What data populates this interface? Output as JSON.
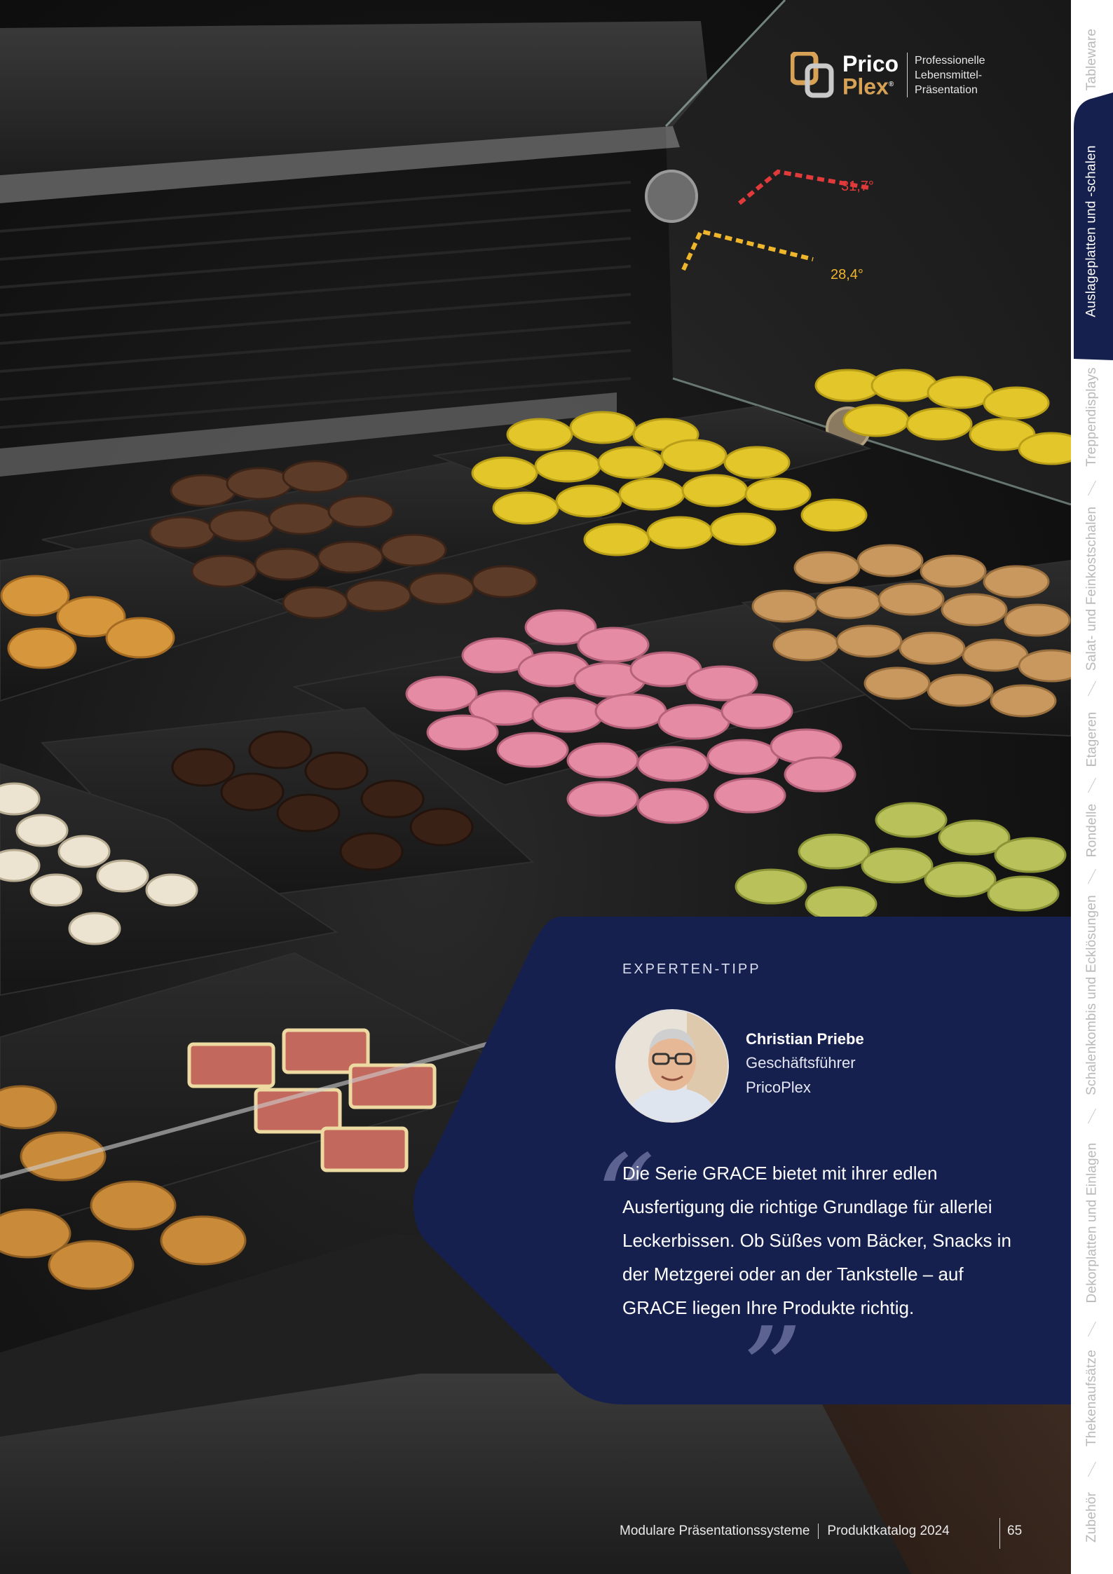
{
  "brand": {
    "word1": "Prico",
    "word2": "Plex",
    "registered": "®",
    "tagline": [
      "Professionelle",
      "Lebensmittel-",
      "Präsentation"
    ],
    "colors": {
      "gold": "#d7a256",
      "navy": "#16204f"
    }
  },
  "tabs": [
    {
      "label": "Tableware",
      "active": false
    },
    {
      "label": "Auslageplatten und -schalen",
      "active": true
    },
    {
      "label": "Treppendisplays",
      "active": false
    },
    {
      "label": "Salat- und Feinkostschalen",
      "active": false
    },
    {
      "label": "Etageren",
      "active": false
    },
    {
      "label": "Rondelle",
      "active": false
    },
    {
      "label": "Schalenkombis und Ecklösungen",
      "active": false
    },
    {
      "label": "Dekorplatten und Einlagen",
      "active": false
    },
    {
      "label": "Thekenaufsätze",
      "active": false
    },
    {
      "label": "Zubehör",
      "active": false
    }
  ],
  "photo": {
    "overlay_labels": [
      "31,7°",
      "28,4°"
    ]
  },
  "expert": {
    "kicker": "EXPERTEN-TIPP",
    "name": "Christian Priebe",
    "role": "Geschäftsführer",
    "company": "PricoPlex",
    "quote": "Die Serie GRACE bietet mit ihrer edlen Ausfertigung die richtige Grundlage für allerlei Leckerbissen. Ob Süßes vom Bäcker, Snacks in der Metzgerei oder an der Tankstelle – auf GRACE liegen Ihre Produkte richtig."
  },
  "footer": {
    "left": "Modulare Präsentationssysteme",
    "right": "Produktkatalog 2024",
    "page": "65"
  }
}
